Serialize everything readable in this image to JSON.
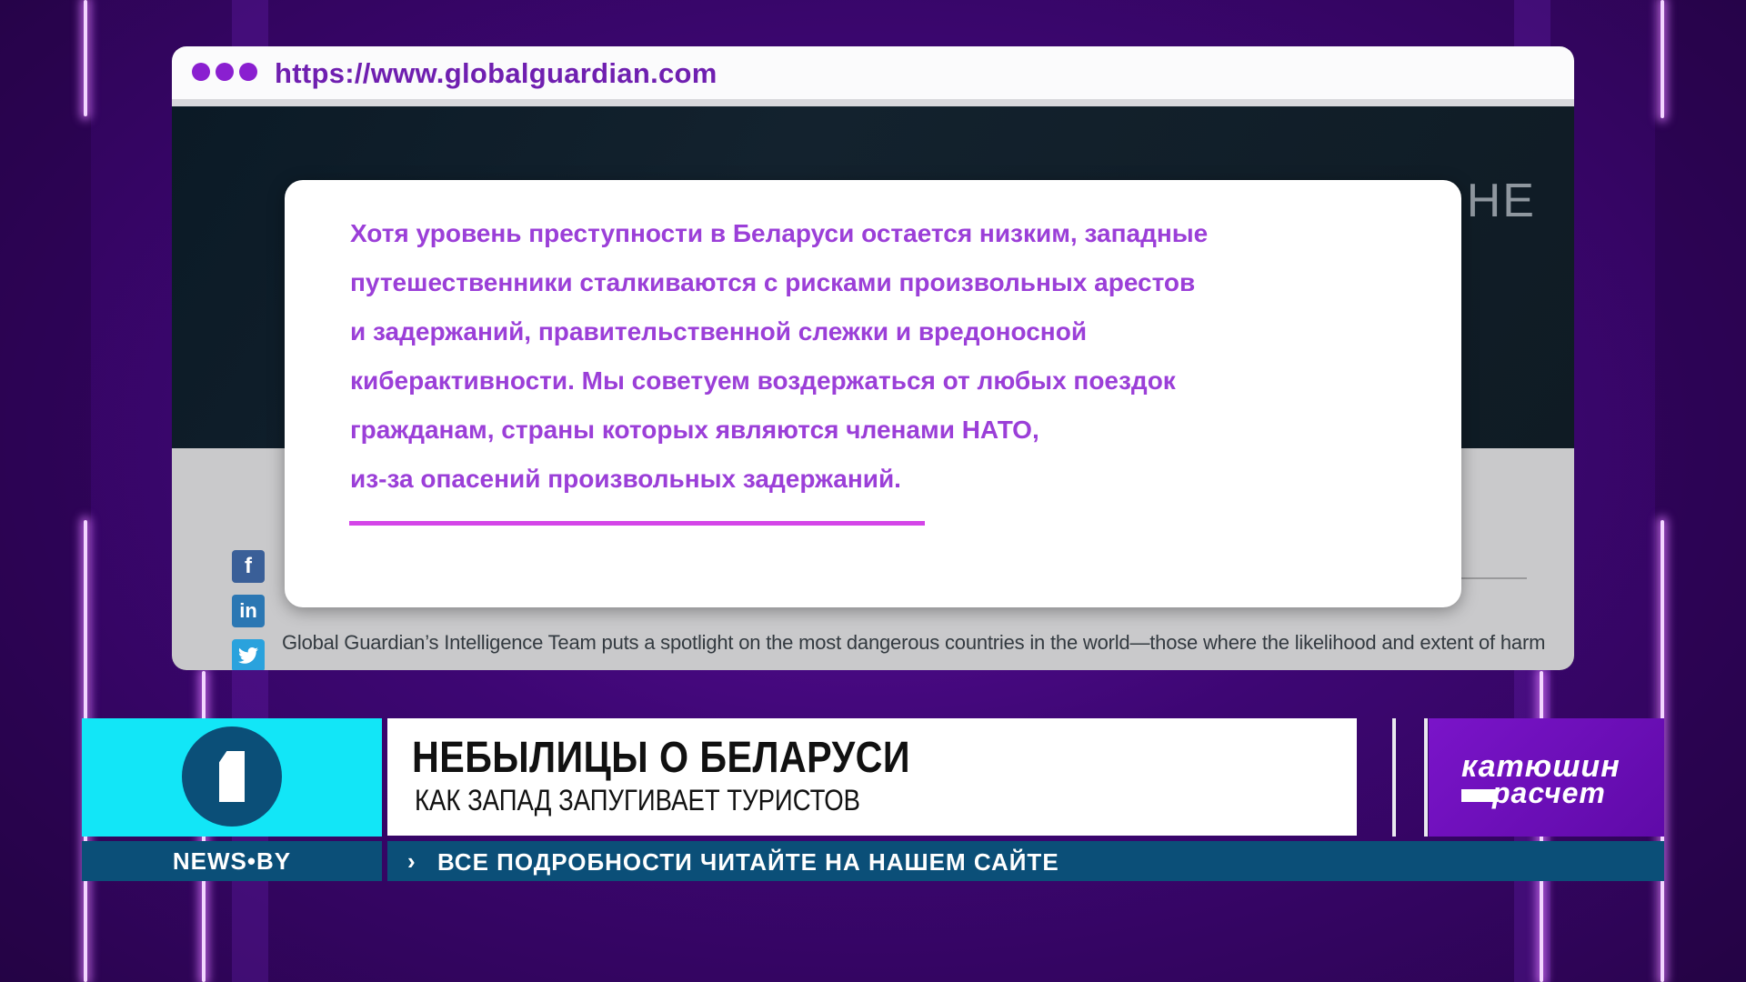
{
  "browser": {
    "url": "https://www.globalguardian.com",
    "hero_fragment": "НЕ",
    "article_text": "Global Guardian’s Intelligence Team puts a spotlight on the most dangerous countries in the world—those where the likelihood and extent of harm",
    "social_icons": [
      "facebook-icon",
      "linkedin-icon",
      "twitter-icon"
    ]
  },
  "quote": {
    "lines": [
      "Хотя уровень преступности в Беларуси остается низким, западные",
      "путешественники сталкиваются с рисками произвольных арестов",
      "и задержаний, правительственной слежки и вредоносной",
      "кибер­активности. Мы советуем воздержаться от любых поездок",
      "гражданам, страны которых являются членами НАТО,",
      "из-за опасений произвольных задержаний."
    ],
    "color": "#9b3fd8"
  },
  "lower_third": {
    "title": "НЕБЫЛИЦЫ О БЕЛАРУСИ",
    "subtitle": "КАК ЗАПАД ЗАПУГИВАЕТ ТУРИСТОВ",
    "brand_line1": "катюшин",
    "brand_line2": "расчет",
    "channel_site": "NEWS•BY",
    "ticker": "ВСЕ ПОДРОБНОСТИ ЧИТАЙТЕ НА НАШЕМ САЙТЕ",
    "ticker_chevron": "›",
    "accent_cyan": "#12e6f7",
    "accent_navy": "#0b4f78"
  }
}
